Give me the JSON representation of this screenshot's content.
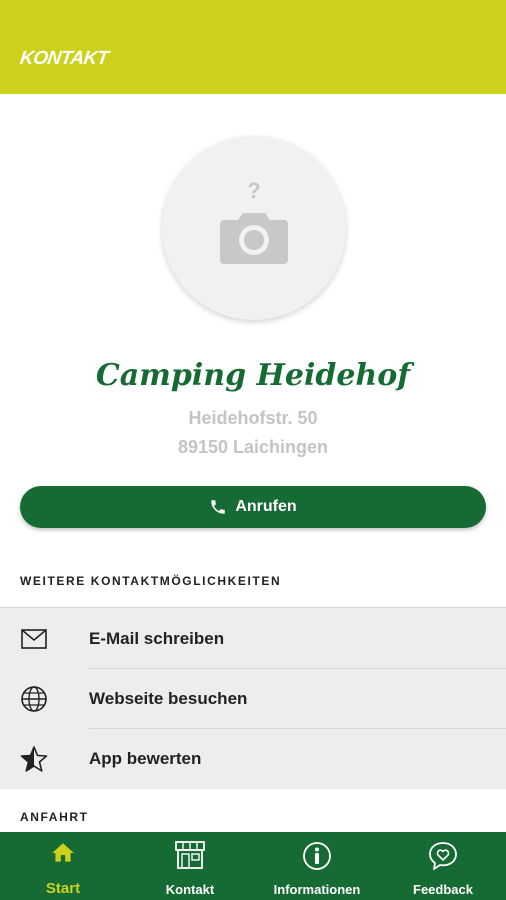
{
  "header": {
    "title": "KONTAKT"
  },
  "profile": {
    "image_icon": "camera-question-icon",
    "name": "Camping Heidehof",
    "address_line1": "Heidehofstr. 50",
    "address_line2": "89150 Laichingen"
  },
  "call_button": {
    "label": "Anrufen",
    "icon": "phone-icon"
  },
  "sections": {
    "more_contact": "WEITERE KONTAKTMÖGLICHKEITEN",
    "directions": "ANFAHRT"
  },
  "contact_items": [
    {
      "label": "E-Mail schreiben",
      "icon": "envelope-icon"
    },
    {
      "label": "Webseite besuchen",
      "icon": "globe-icon"
    },
    {
      "label": "App bewerten",
      "icon": "star-icon"
    }
  ],
  "bottom_nav": [
    {
      "label": "Start",
      "icon": "home-icon",
      "active": true
    },
    {
      "label": "Kontakt",
      "icon": "shop-icon",
      "active": false
    },
    {
      "label": "Informationen",
      "icon": "info-icon",
      "active": false
    },
    {
      "label": "Feedback",
      "icon": "heart-chat-icon",
      "active": false
    }
  ],
  "colors": {
    "header": "#cdd11b",
    "primary_green": "#156b33",
    "active_nav": "#cdd11b",
    "list_background": "#ededed"
  }
}
